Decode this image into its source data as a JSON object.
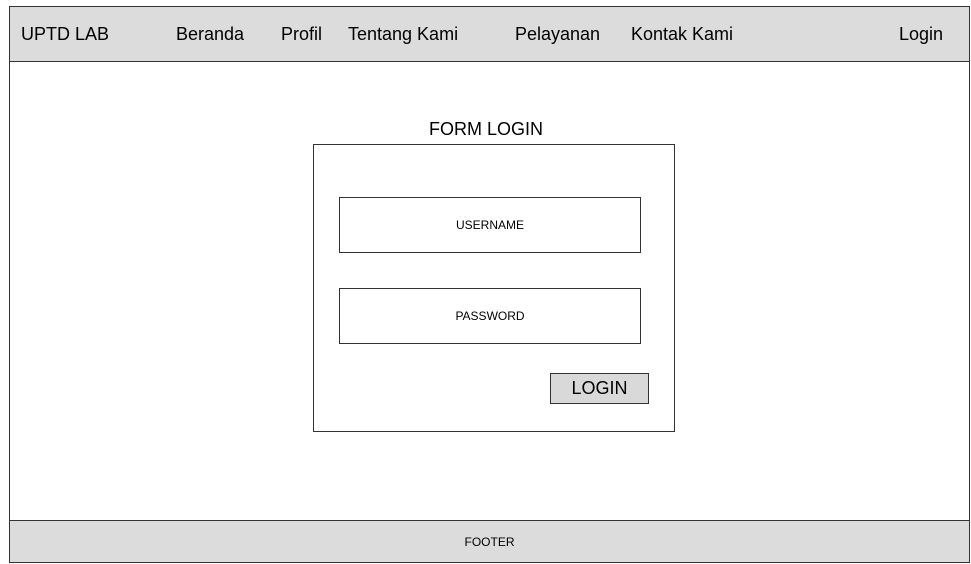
{
  "navbar": {
    "brand": "UPTD LAB",
    "items": [
      "Beranda",
      "Profil",
      "Tentang Kami",
      "Pelayanan",
      "Kontak Kami"
    ],
    "login_link": "Login"
  },
  "form": {
    "title": "FORM LOGIN",
    "username_placeholder": "USERNAME",
    "password_placeholder": "PASSWORD",
    "submit_label": "LOGIN"
  },
  "footer": {
    "label": "FOOTER"
  },
  "colors": {
    "bar_background": "#dcdcdc",
    "button_background": "#d9d9d9",
    "border": "#333333"
  }
}
